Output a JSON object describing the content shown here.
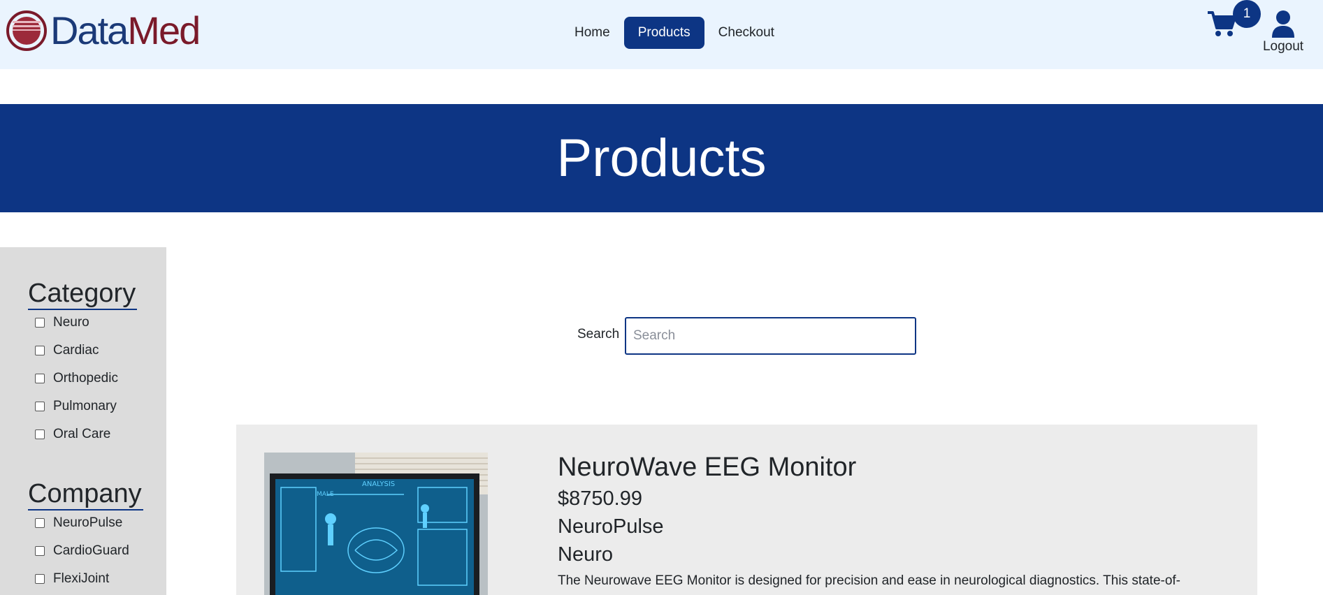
{
  "brand": {
    "part1": "Data",
    "part2": "Med"
  },
  "nav": {
    "items": [
      {
        "label": "Home",
        "active": false
      },
      {
        "label": "Products",
        "active": true
      },
      {
        "label": "Checkout",
        "active": false
      }
    ]
  },
  "header": {
    "cart_icon": "cart-icon",
    "cart_count": "1",
    "user_icon": "user-icon",
    "logout_label": "Logout"
  },
  "banner": {
    "title": "Products"
  },
  "sidebar": {
    "category_title": "Category",
    "categories": [
      "Neuro",
      "Cardiac",
      "Orthopedic",
      "Pulmonary",
      "Oral Care"
    ],
    "company_title": "Company",
    "companies": [
      "NeuroPulse",
      "CardioGuard",
      "FlexiJoint"
    ]
  },
  "search": {
    "label": "Search",
    "placeholder": "Search",
    "value": ""
  },
  "products": [
    {
      "name": "NeuroWave EEG Monitor",
      "price": "$8750.99",
      "company": "NeuroPulse",
      "category": "Neuro",
      "description": "The Neurowave EEG Monitor is designed for precision and ease in neurological diagnostics. This state-of-",
      "image_labels": {
        "top": "ANALYSIS",
        "figure": "MALE"
      }
    }
  ],
  "colors": {
    "primary": "#0d3584",
    "header_bg": "#eaf4fe",
    "sidebar_bg": "#dcdcdc",
    "card_bg": "#ececec",
    "logo_red": "#7a1a2a"
  }
}
